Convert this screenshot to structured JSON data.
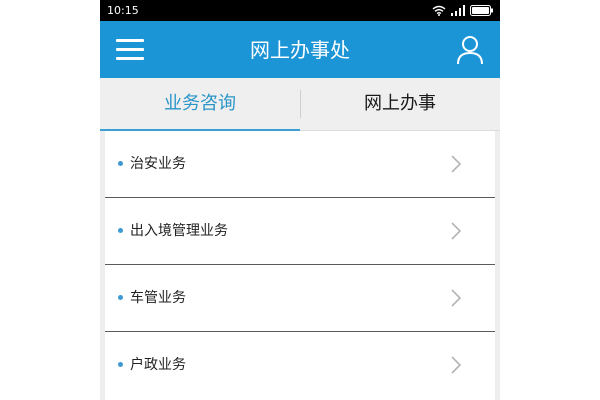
{
  "status_bar": {
    "time": "10:15",
    "icons": [
      "wifi-icon",
      "signal-icon",
      "battery-icon"
    ]
  },
  "header": {
    "title": "网上办事处",
    "left_icon": "menu-icon",
    "right_icon": "user-icon"
  },
  "tabs": [
    {
      "label": "业务咨询",
      "active": true
    },
    {
      "label": "网上办事",
      "active": false
    }
  ],
  "list": {
    "items": [
      {
        "label": "治安业务",
        "icon": "chevron-right-icon"
      },
      {
        "label": "出入境管理业务",
        "icon": "chevron-right-icon"
      },
      {
        "label": "车管业务",
        "icon": "chevron-right-icon"
      },
      {
        "label": "户政业务",
        "icon": "chevron-right-icon"
      }
    ]
  },
  "colors": {
    "header_bg": "#1b95d6",
    "active_tab_text": "#2a95c8",
    "bullet": "#3d9ad0",
    "status_bar_bg": "#000000"
  }
}
